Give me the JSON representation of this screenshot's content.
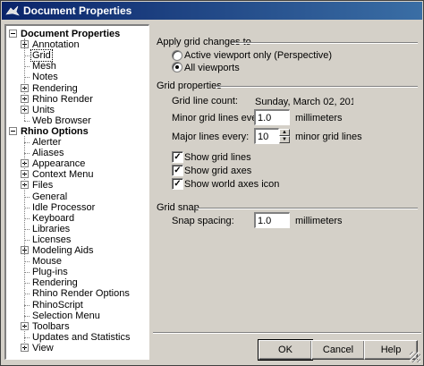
{
  "window": {
    "title": "Document Properties",
    "icon": "rhino-icon"
  },
  "tree": [
    {
      "label": "Document Properties",
      "level": 0,
      "bold": true,
      "expander": "minus"
    },
    {
      "label": "Annotation",
      "level": 1,
      "expander": "plus"
    },
    {
      "label": "Grid",
      "level": 1,
      "selected": true
    },
    {
      "label": "Mesh",
      "level": 1
    },
    {
      "label": "Notes",
      "level": 1
    },
    {
      "label": "Rendering",
      "level": 1,
      "expander": "plus"
    },
    {
      "label": "Rhino Render",
      "level": 1,
      "expander": "plus"
    },
    {
      "label": "Units",
      "level": 1,
      "expander": "plus"
    },
    {
      "label": "Web Browser",
      "level": 1
    },
    {
      "label": "Rhino Options",
      "level": 0,
      "bold": true,
      "expander": "minus"
    },
    {
      "label": "Alerter",
      "level": 1
    },
    {
      "label": "Aliases",
      "level": 1
    },
    {
      "label": "Appearance",
      "level": 1,
      "expander": "plus"
    },
    {
      "label": "Context Menu",
      "level": 1,
      "expander": "plus"
    },
    {
      "label": "Files",
      "level": 1,
      "expander": "plus"
    },
    {
      "label": "General",
      "level": 1
    },
    {
      "label": "Idle Processor",
      "level": 1
    },
    {
      "label": "Keyboard",
      "level": 1
    },
    {
      "label": "Libraries",
      "level": 1
    },
    {
      "label": "Licenses",
      "level": 1
    },
    {
      "label": "Modeling Aids",
      "level": 1,
      "expander": "plus"
    },
    {
      "label": "Mouse",
      "level": 1
    },
    {
      "label": "Plug-ins",
      "level": 1
    },
    {
      "label": "Rendering",
      "level": 1
    },
    {
      "label": "Rhino Render Options",
      "level": 1
    },
    {
      "label": "RhinoScript",
      "level": 1
    },
    {
      "label": "Selection Menu",
      "level": 1
    },
    {
      "label": "Toolbars",
      "level": 1,
      "expander": "plus"
    },
    {
      "label": "Updates and Statistics",
      "level": 1
    },
    {
      "label": "View",
      "level": 1,
      "expander": "plus"
    }
  ],
  "apply": {
    "title": "Apply grid changes to",
    "option_active": "Active viewport only (Perspective)",
    "option_all": "All viewports",
    "selected": "all"
  },
  "grid_props": {
    "title": "Grid properties",
    "line_count_label": "Grid line count:",
    "line_count_value": "Sunday, March 02, 2014",
    "minor_label": "Minor grid lines every:",
    "minor_value": "1.0",
    "minor_unit": "millimeters",
    "major_label": "Major lines every:",
    "major_value": "10",
    "major_unit": "minor grid lines",
    "show_lines": "Show grid lines",
    "show_axes": "Show grid axes",
    "show_world": "Show world axes icon",
    "checked": [
      true,
      true,
      true
    ]
  },
  "snap": {
    "title": "Grid snap",
    "spacing_label": "Snap spacing:",
    "spacing_value": "1.0",
    "spacing_unit": "millimeters"
  },
  "buttons": {
    "ok": "OK",
    "cancel": "Cancel",
    "help": "Help"
  }
}
